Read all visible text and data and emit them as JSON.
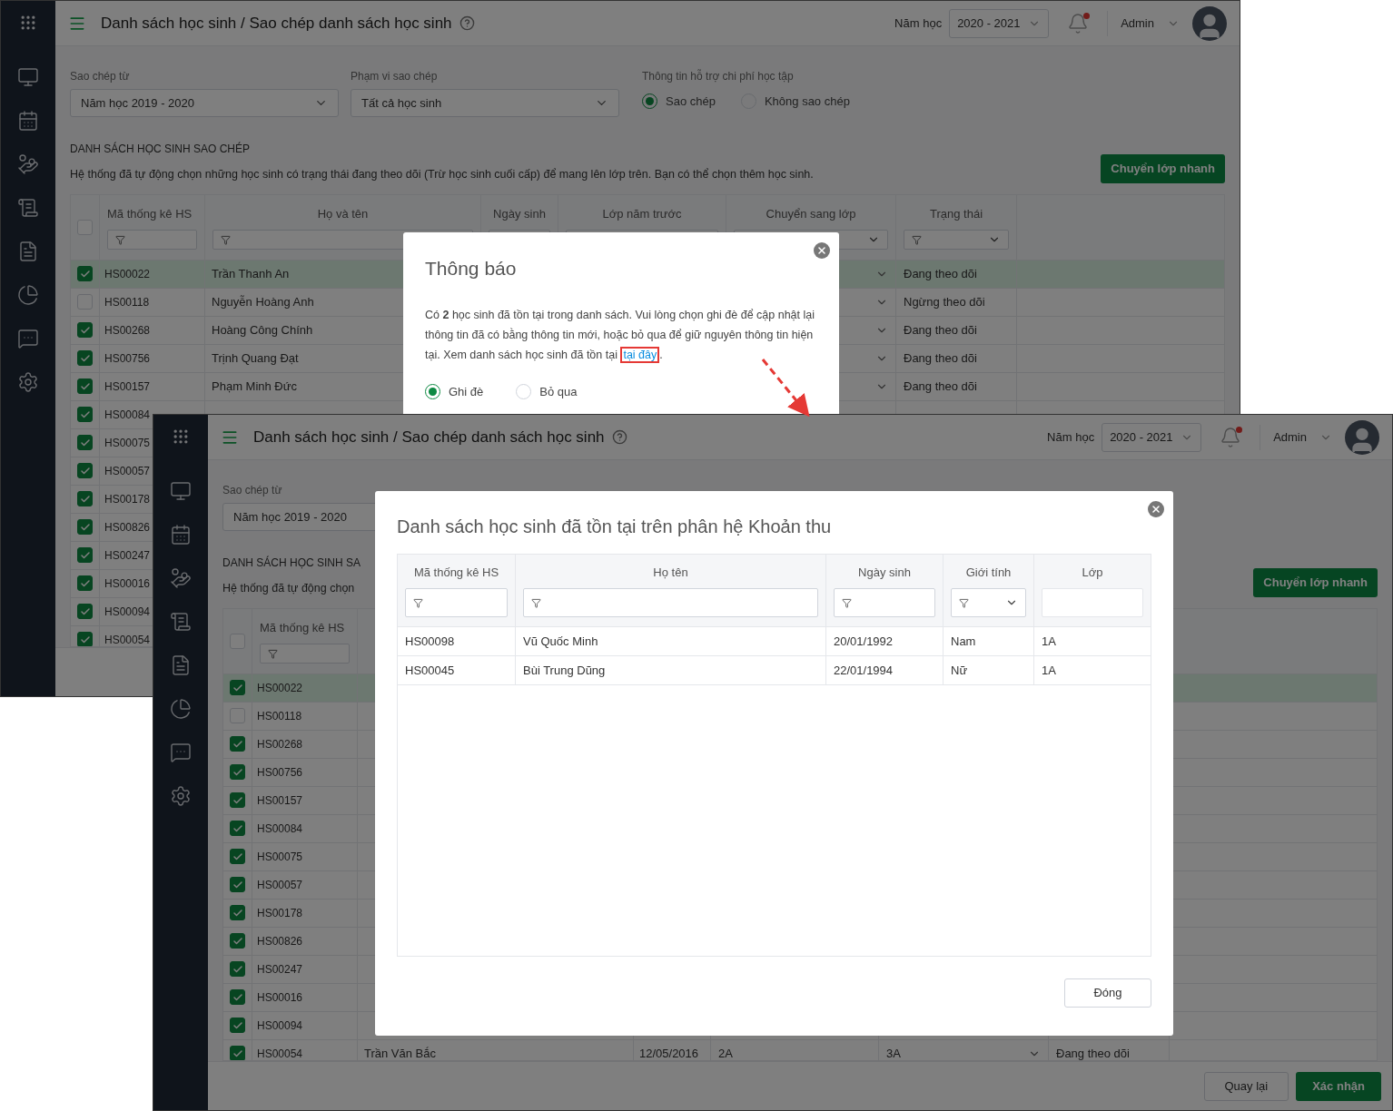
{
  "screens": [
    {
      "header": {
        "title": "Danh sách học sinh / Sao chép danh sách học sinh",
        "year_label": "Năm học",
        "year": "2020 - 2021",
        "user": "Admin"
      },
      "form": {
        "copy_from": {
          "label": "Sao chép từ",
          "value": "Năm học 2019 - 2020",
          "dropdown": true
        },
        "scope": {
          "label": "Phạm vi sao chép",
          "value": "Tất cả học sinh",
          "dropdown": true
        },
        "support": {
          "label": "Thông tin hỗ trợ chi phí học tập",
          "options": [
            {
              "label": "Sao chép",
              "selected": true
            },
            {
              "label": "Không sao chép",
              "selected": false
            }
          ]
        }
      },
      "section_title": "DANH SÁCH HỌC SINH SAO CHÉP",
      "description": "Hệ thống đã tự động chọn những học sinh có trạng thái đang theo dõi (Trừ học sinh cuối cấp) để mang lên lớp trên. Bạn có thể chọn thêm học sinh.",
      "quick_button": "Chuyển lớp nhanh",
      "table": {
        "all_checked": false,
        "columns": [
          {
            "label": "Mã thống kê HS",
            "kind": "text"
          },
          {
            "label": "Họ và tên",
            "kind": "text"
          },
          {
            "label": "Ngày sinh",
            "kind": "plain"
          },
          {
            "label": "Lớp năm trước",
            "kind": "plain"
          },
          {
            "label": "Chuyển sang lớp",
            "kind": "dropdown"
          },
          {
            "label": "Trạng thái",
            "kind": "select"
          }
        ],
        "rows": [
          {
            "checked": true,
            "selected": true,
            "code": "HS00022",
            "name": "Trần Thanh An",
            "status": "Đang theo dõi"
          },
          {
            "checked": false,
            "selected": false,
            "code": "HS00118",
            "name": "Nguyễn Hoàng Anh",
            "status": "Ngừng theo dõi"
          },
          {
            "checked": true,
            "selected": false,
            "code": "HS00268",
            "name": "Hoàng Công Chính",
            "status": "Đang theo dõi"
          },
          {
            "checked": true,
            "selected": false,
            "code": "HS00756",
            "name": "Trịnh Quang Đạt",
            "status": "Đang theo dõi"
          },
          {
            "checked": true,
            "selected": false,
            "code": "HS00157",
            "name": "Phạm Minh Đức",
            "status": "Đang theo dõi"
          },
          {
            "checked": true,
            "selected": false,
            "code": "HS00084"
          },
          {
            "checked": true,
            "selected": false,
            "code": "HS00075"
          },
          {
            "checked": true,
            "selected": false,
            "code": "HS00057"
          },
          {
            "checked": true,
            "selected": false,
            "code": "HS00178"
          },
          {
            "checked": true,
            "selected": false,
            "code": "HS00826"
          },
          {
            "checked": true,
            "selected": false,
            "code": "HS00247"
          },
          {
            "checked": true,
            "selected": false,
            "code": "HS00016"
          },
          {
            "checked": true,
            "selected": false,
            "code": "HS00094"
          },
          {
            "checked": true,
            "selected": false,
            "code": "HS00054"
          }
        ]
      },
      "dialog": {
        "kind": "notice",
        "title": "Thông báo",
        "message": "Có **2** học sinh đã tồn tại trong danh sách. Vui lòng chọn ghi đè để cập nhật lại thông tin đã có bằng thông tin mới, hoặc bỏ qua để giữ nguyên thông tin hiện tại. Xem danh sách học sinh đã tồn tại",
        "link": "tại đây",
        "message_end": ".",
        "link_highlighted": true,
        "options": [
          {
            "label": "Ghi đè",
            "selected": true
          },
          {
            "label": "Bỏ qua",
            "selected": false
          }
        ]
      }
    },
    {
      "header": {
        "title": "Danh sách học sinh / Sao chép danh sách học sinh",
        "year_label": "Năm học",
        "year": "2020 - 2021",
        "user": "Admin"
      },
      "form": {
        "copy_from": {
          "label": "Sao chép từ",
          "value": "Năm học 2019 - 2020"
        }
      },
      "section_title": "DANH SÁCH HỌC SINH SA",
      "description": "Hệ thống đã tự động chọn",
      "quick_button": "Chuyển lớp nhanh",
      "table": {
        "all_checked": false,
        "columns": [
          {
            "label": "Mã thống kê HS",
            "kind": "text"
          }
        ],
        "rows": [
          {
            "checked": true,
            "selected": true,
            "code": "HS00022"
          },
          {
            "checked": false,
            "selected": false,
            "code": "HS00118"
          },
          {
            "checked": true,
            "selected": false,
            "code": "HS00268"
          },
          {
            "checked": true,
            "selected": false,
            "code": "HS00756"
          },
          {
            "checked": true,
            "selected": false,
            "code": "HS00157"
          },
          {
            "checked": true,
            "selected": false,
            "code": "HS00084"
          },
          {
            "checked": true,
            "selected": false,
            "code": "HS00075"
          },
          {
            "checked": true,
            "selected": false,
            "code": "HS00057"
          },
          {
            "checked": true,
            "selected": false,
            "code": "HS00178"
          },
          {
            "checked": true,
            "selected": false,
            "code": "HS00826"
          },
          {
            "checked": true,
            "selected": false,
            "code": "HS00247"
          },
          {
            "checked": true,
            "selected": false,
            "code": "HS00016"
          },
          {
            "checked": true,
            "selected": false,
            "code": "HS00094"
          },
          {
            "checked": true,
            "selected": false,
            "code": "HS00054",
            "name": "Trần Văn Bắc",
            "birth": "12/05/2016",
            "prev_class": "2A",
            "next_class": "3A",
            "status": "Đang theo dõi"
          }
        ]
      },
      "footer": {
        "back": "Quay lại",
        "confirm": "Xác nhận"
      },
      "dialog": {
        "kind": "list",
        "title": "Danh sách học sinh đã tồn tại trên phân hệ Khoản thu",
        "columns": [
          {
            "label": "Mã thống kê HS",
            "kind": "text"
          },
          {
            "label": "Họ tên",
            "kind": "text"
          },
          {
            "label": "Ngày sinh",
            "kind": "text"
          },
          {
            "label": "Giới tính",
            "kind": "select"
          },
          {
            "label": "Lớp",
            "kind": "plain"
          }
        ],
        "rows": [
          [
            "HS00098",
            "Vũ Quốc Minh",
            "20/01/1992",
            "Nam",
            "1A"
          ],
          [
            "HS00045",
            "Bùi Trung Dũng",
            "22/01/1994",
            "Nữ",
            "1A"
          ]
        ],
        "close_button": "Đóng"
      }
    }
  ]
}
